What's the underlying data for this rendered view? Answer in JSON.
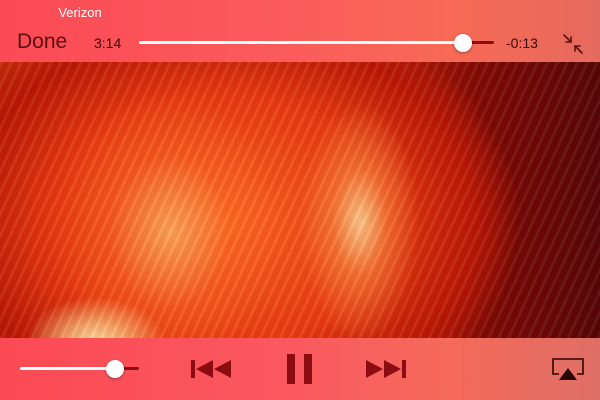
{
  "status_bar": {
    "carrier": "Verizon"
  },
  "top_controls": {
    "done_label": "Done",
    "elapsed": "3:14",
    "remaining": "-0:13",
    "progress_fraction": 0.913
  },
  "bottom_controls": {
    "volume_fraction": 0.8,
    "buttons": [
      "skip-back-icon",
      "pause-icon",
      "skip-forward-icon",
      "airplay-icon"
    ]
  },
  "colors": {
    "bar_accent": "#fb4a54",
    "track_filled": "#ffffff",
    "track_empty": "#8a0e14",
    "icon_color": "#8c0c12",
    "label_dark": "#5a1010"
  }
}
